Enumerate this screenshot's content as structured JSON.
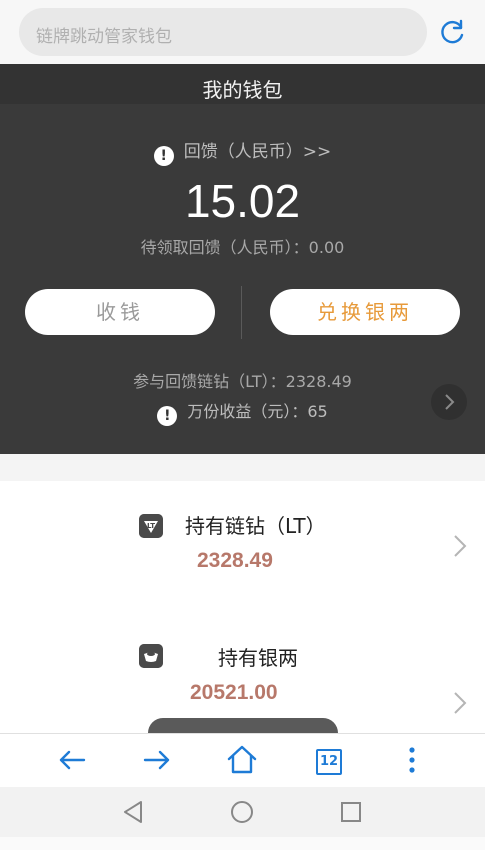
{
  "search": {
    "placeholder": "链牌跳动管家钱包"
  },
  "wallet": {
    "title": "我的钱包",
    "rebate_label": "回馈（人民币）>>",
    "rebate_amount": "15.02",
    "pending_label": "待领取回馈（人民币）：0.00",
    "receive_button": "收钱",
    "exchange_button": "兑换银两",
    "lt_participation": "参与回馈链钻（LT）：2328.49",
    "yield_label": "万份收益（元）：65"
  },
  "assets": [
    {
      "label": "持有链钻（LT）",
      "value": "2328.49",
      "icon": "lt-diamond-icon"
    },
    {
      "label": "持有银两",
      "value": "20521.00",
      "icon": "silver-ingot-icon"
    }
  ],
  "toolbar": {
    "tabs_count": "12"
  },
  "colors": {
    "accent_blue": "#1e7bd6",
    "exchange_orange": "#e79a3a",
    "value_brown": "#b7786a",
    "panel_dark": "#3a3a3a"
  }
}
